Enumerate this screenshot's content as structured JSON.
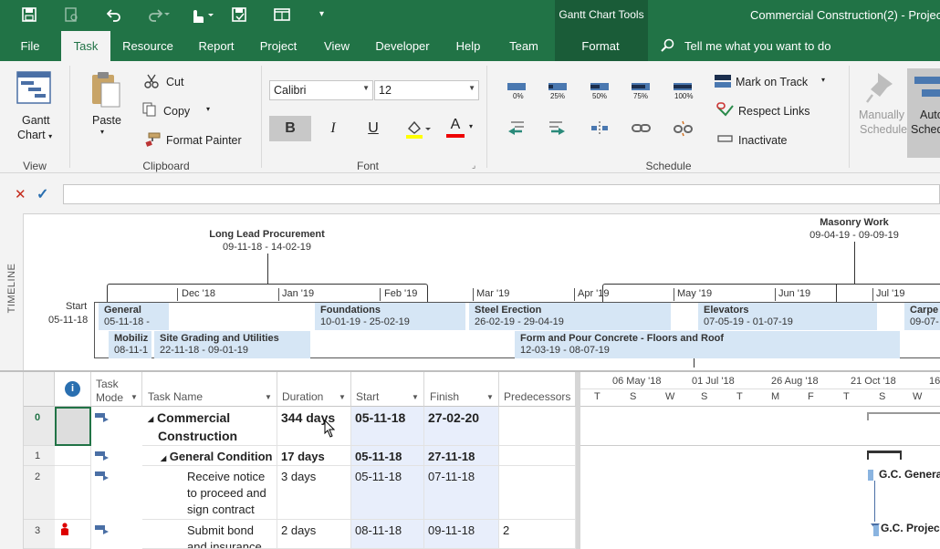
{
  "window": {
    "context_tab_group": "Gantt Chart Tools",
    "title": "Commercial Construction(2) - Project"
  },
  "tabs": [
    "File",
    "Task",
    "Resource",
    "Report",
    "Project",
    "View",
    "Developer",
    "Help",
    "Team",
    "Format"
  ],
  "active_tab": "Task",
  "tell_me": "Tell me what you want to do",
  "ribbon": {
    "view_group": {
      "gantt_label_1": "Gantt",
      "gantt_label_2": "Chart",
      "group_label": "View"
    },
    "clipboard": {
      "paste": "Paste",
      "cut": "Cut",
      "copy": "Copy",
      "format_painter": "Format Painter",
      "group_label": "Clipboard"
    },
    "font": {
      "family": "Calibri",
      "size": "12",
      "bold": "B",
      "italic": "I",
      "underline": "U",
      "font_color": "A",
      "group_label": "Font"
    },
    "schedule": {
      "pct": [
        "0%",
        "25%",
        "50%",
        "75%",
        "100%"
      ],
      "mark_on_track": "Mark on Track",
      "respect_links": "Respect Links",
      "inactivate": "Inactivate",
      "group_label": "Schedule"
    },
    "tasks": {
      "manually": "Manually",
      "schedule": "Schedule",
      "auto": "Auto",
      "sched": "Sched"
    }
  },
  "timeline": {
    "side_label": "TIMELINE",
    "start_label": "Start",
    "start_date": "05-11-18",
    "months": [
      "Dec '18",
      "Jan '19",
      "Feb '19",
      "Mar '19",
      "Apr '19",
      "May '19",
      "Jun '19",
      "Jul '19"
    ],
    "callouts": [
      {
        "name": "Long Lead Procurement",
        "dates": "09-11-18 - 14-02-19"
      },
      {
        "name": "Masonry Work",
        "dates": "09-04-19 - 09-09-19"
      }
    ],
    "bars_row1": [
      {
        "name": "General",
        "dates": "05-11-18 -"
      },
      {
        "name": "Foundations",
        "dates": "10-01-19 - 25-02-19"
      },
      {
        "name": "Steel Erection",
        "dates": "26-02-19 - 29-04-19"
      },
      {
        "name": "Elevators",
        "dates": "07-05-19 - 01-07-19"
      },
      {
        "name": "Carpe",
        "dates": "09-07-"
      }
    ],
    "bars_row2": [
      {
        "name": "Mobiliz",
        "dates": "08-11-1"
      },
      {
        "name": "Site Grading and Utilities",
        "dates": "22-11-18 - 09-01-19"
      },
      {
        "name": "Form and Pour Concrete - Floors and Roof",
        "dates": "12-03-19 - 08-07-19"
      }
    ]
  },
  "grid": {
    "headers": {
      "task_mode_1": "Task",
      "task_mode_2": "Mode",
      "task_name": "Task Name",
      "duration": "Duration",
      "start": "Start",
      "finish": "Finish",
      "predecessors": "Predecessors"
    },
    "rows": [
      {
        "id": "0",
        "name_1": "Commercial",
        "name_2": "Construction",
        "duration": "344 days",
        "start": "05-11-18",
        "finish": "27-02-20",
        "pred": ""
      },
      {
        "id": "1",
        "name_1": "General Condition",
        "duration": "17 days",
        "start": "05-11-18",
        "finish": "27-11-18",
        "pred": ""
      },
      {
        "id": "2",
        "name_1": "Receive notice",
        "name_2": "to proceed and",
        "name_3": "sign contract",
        "duration": "3 days",
        "start": "05-11-18",
        "finish": "07-11-18",
        "pred": ""
      },
      {
        "id": "3",
        "name_1": "Submit bond",
        "name_2": "and insurance",
        "duration": "2 days",
        "start": "08-11-18",
        "finish": "09-11-18",
        "pred": "2"
      }
    ]
  },
  "gantt": {
    "weeks": [
      "06 May '18",
      "01 Jul '18",
      "26 Aug '18",
      "21 Oct '18",
      "16"
    ],
    "days": [
      "T",
      "S",
      "W",
      "S",
      "T",
      "M",
      "F",
      "T",
      "S",
      "W"
    ],
    "labels": [
      "G.C. Genera",
      "G.C. Projec"
    ]
  },
  "colors": {
    "accent": "#217346",
    "timeline_bar": "#d6e6f5",
    "mode_icon": "#4a6fa5",
    "indicator": "#cc0000"
  }
}
